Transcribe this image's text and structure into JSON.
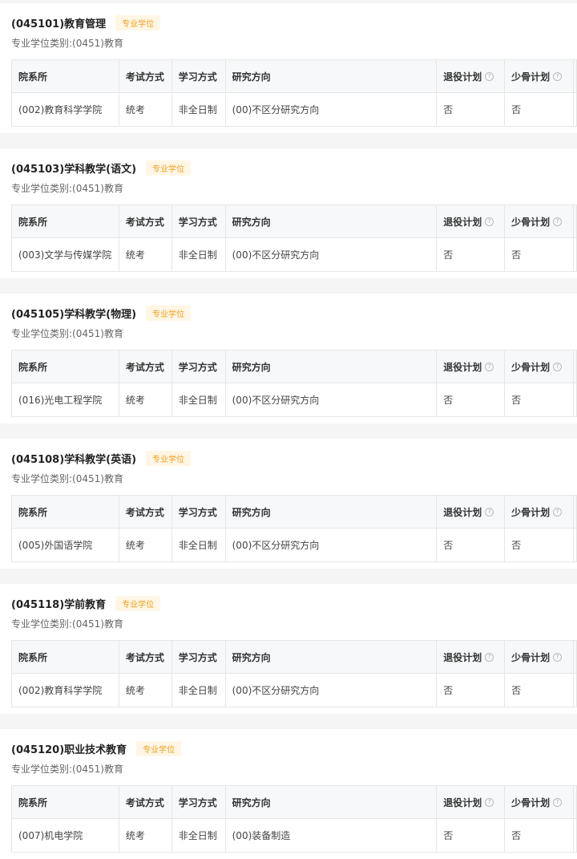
{
  "header_labels": {
    "col_department": "院系所",
    "col_exam": "考试方式",
    "col_study": "学习方式",
    "col_direction": "研究方向",
    "col_veteran": "退役计划",
    "col_minority": "少骨计划",
    "subtitle_label": "专业学位类别:"
  },
  "icons": {
    "help": "question-circle-icon"
  },
  "colors": {
    "badge_text": "#f0a020",
    "badge_bg": "#fff6e5"
  },
  "programs": [
    {
      "title": "(045101)教育管理",
      "badge": "专业学位",
      "category": "(0451)教育",
      "row": {
        "department": "(002)教育科学学院",
        "exam": "统考",
        "study": "非全日制",
        "direction": "(00)不区分研究方向",
        "veteran": "否",
        "minority": "否"
      }
    },
    {
      "title": "(045103)学科教学(语文)",
      "badge": "专业学位",
      "category": "(0451)教育",
      "row": {
        "department": "(003)文学与传媒学院",
        "exam": "统考",
        "study": "非全日制",
        "direction": "(00)不区分研究方向",
        "veteran": "否",
        "minority": "否"
      }
    },
    {
      "title": "(045105)学科教学(物理)",
      "badge": "专业学位",
      "category": "(0451)教育",
      "row": {
        "department": "(016)光电工程学院",
        "exam": "统考",
        "study": "非全日制",
        "direction": "(00)不区分研究方向",
        "veteran": "否",
        "minority": "否"
      }
    },
    {
      "title": "(045108)学科教学(英语)",
      "badge": "专业学位",
      "category": "(0451)教育",
      "row": {
        "department": "(005)外国语学院",
        "exam": "统考",
        "study": "非全日制",
        "direction": "(00)不区分研究方向",
        "veteran": "否",
        "minority": "否"
      }
    },
    {
      "title": "(045118)学前教育",
      "badge": "专业学位",
      "category": "(0451)教育",
      "row": {
        "department": "(002)教育科学学院",
        "exam": "统考",
        "study": "非全日制",
        "direction": "(00)不区分研究方向",
        "veteran": "否",
        "minority": "否"
      }
    },
    {
      "title": "(045120)职业技术教育",
      "badge": "专业学位",
      "category": "(0451)教育",
      "row": {
        "department": "(007)机电学院",
        "exam": "统考",
        "study": "非全日制",
        "direction": "(00)装备制造",
        "veteran": "否",
        "minority": "否"
      }
    }
  ]
}
